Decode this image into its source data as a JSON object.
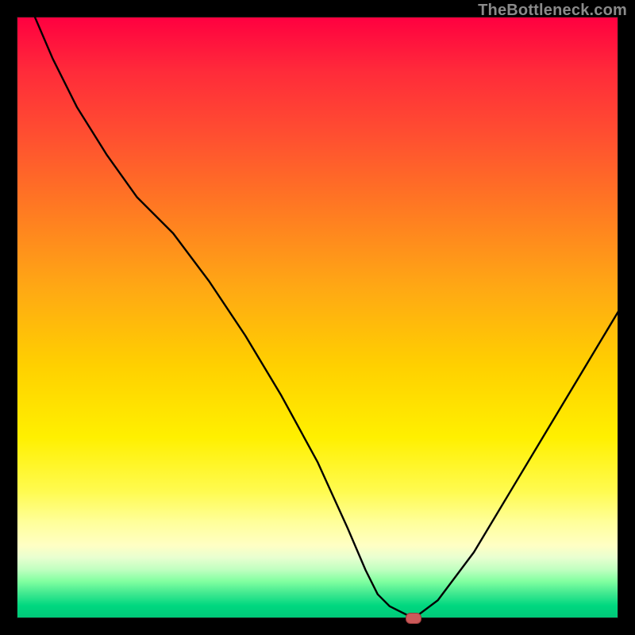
{
  "watermark": "TheBottleneck.com",
  "chart_data": {
    "type": "line",
    "title": "",
    "xlabel": "",
    "ylabel": "",
    "xlim": [
      0,
      100
    ],
    "ylim": [
      0,
      100
    ],
    "grid": false,
    "legend": false,
    "series": [
      {
        "name": "bottleneck-curve",
        "x": [
          3,
          6,
          10,
          15,
          20,
          26,
          32,
          38,
          44,
          50,
          55,
          58,
          60,
          62,
          64,
          66,
          70,
          76,
          82,
          88,
          94,
          100
        ],
        "values": [
          100,
          93,
          85,
          77,
          70,
          64,
          56,
          47,
          37,
          26,
          15,
          8,
          4,
          2,
          1,
          0,
          3,
          11,
          21,
          31,
          41,
          51
        ]
      }
    ],
    "markers": [
      {
        "name": "optimal-point",
        "x": 66,
        "y": 0
      }
    ]
  },
  "colors": {
    "curve": "#000000",
    "marker_fill": "#cc5a5a",
    "marker_border": "#9a3b3b",
    "background_black": "#000000"
  }
}
